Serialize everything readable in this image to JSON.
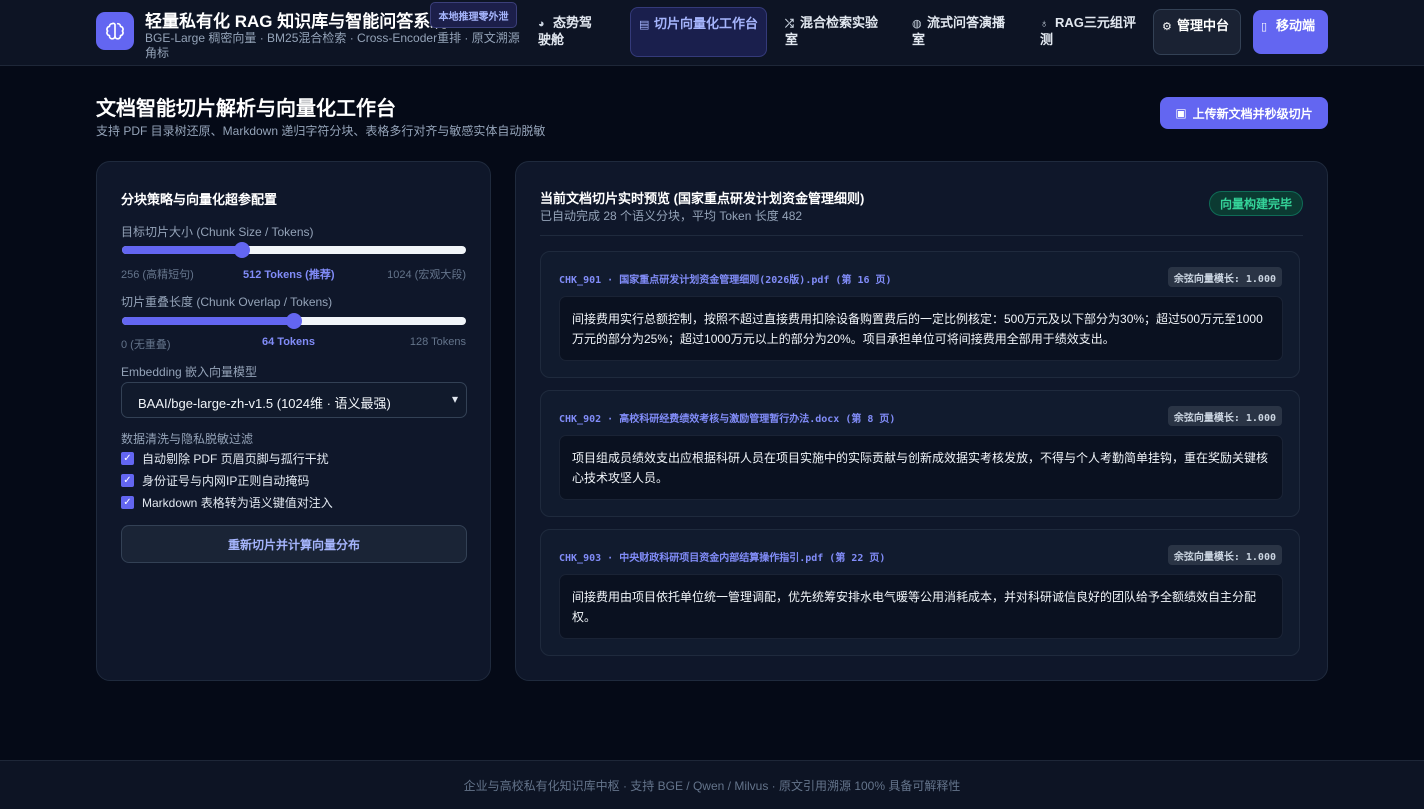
{
  "header": {
    "title": "轻量私有化 RAG 知识库与智能问答系统",
    "badge": "本地推理零外泄",
    "subtitle": "BGE-Large 稠密向量 · BM25混合检索 · Cross-Encoder重排 · 原文溯源角标",
    "logo_icon": "brain-icon",
    "nav": [
      {
        "icon": "dashboard-icon",
        "label": "态势驾驶舱",
        "active": false
      },
      {
        "icon": "document-icon",
        "label": "切片向量化工作台",
        "active": true
      },
      {
        "icon": "shuffle-icon",
        "label": "混合检索实验室",
        "active": false
      },
      {
        "icon": "chat-icon",
        "label": "流式问答演播室",
        "active": false
      },
      {
        "icon": "medal-icon",
        "label": "RAG三元组评测",
        "active": false
      },
      {
        "icon": "gear-icon",
        "label": "管理中台",
        "active": false
      },
      {
        "icon": "mobile-icon",
        "label": "移动端",
        "active": false
      }
    ]
  },
  "page": {
    "title": "文档智能切片解析与向量化工作台",
    "subtitle": "支持 PDF 目录树还原、Markdown 递归字符分块、表格多行对齐与敏感实体自动脱敏",
    "upload_button": "上传新文档并秒级切片"
  },
  "config": {
    "title": "分块策略与向量化超参配置",
    "chunk_size": {
      "label": "目标切片大小 (Chunk Size / Tokens)",
      "value_fraction": 0.35,
      "min_label": "256 (高精短句)",
      "current_label": "512 Tokens (推荐)",
      "max_label": "1024 (宏观大段)"
    },
    "chunk_overlap": {
      "label": "切片重叠长度 (Chunk Overlap / Tokens)",
      "value_fraction": 0.5,
      "min_label": "0 (无重叠)",
      "current_label": "64 Tokens",
      "max_label": "128 Tokens"
    },
    "embedding": {
      "label": "Embedding 嵌入向量模型",
      "selected": "BAAI/bge-large-zh-v1.5 (1024维 · 语义最强)"
    },
    "cleaning": {
      "label": "数据清洗与隐私脱敏过滤",
      "options": [
        {
          "label": "自动剔除 PDF 页眉页脚与孤行干扰",
          "checked": true
        },
        {
          "label": "身份证号与内网IP正则自动掩码",
          "checked": true
        },
        {
          "label": "Markdown 表格转为语义键值对注入",
          "checked": true
        }
      ]
    },
    "rebuild_button": "重新切片并计算向量分布"
  },
  "preview": {
    "title": "当前文档切片实时预览 (国家重点研发计划资金管理细则)",
    "subtitle": "已自动完成 28 个语义分块，平均 Token 长度 482",
    "status": "向量构建完毕",
    "chunks": [
      {
        "header": "CHK_901 · 国家重点研发计划资金管理细则(2026版).pdf (第 16 页)",
        "score": "余弦向量模长: 1.000",
        "text": "间接费用实行总额控制，按照不超过直接费用扣除设备购置费后的一定比例核定：500万元及以下部分为30%；超过500万元至1000万元的部分为25%；超过1000万元以上的部分为20%。项目承担单位可将间接费用全部用于绩效支出。"
      },
      {
        "header": "CHK_902 · 高校科研经费绩效考核与激励管理暂行办法.docx (第 8 页)",
        "score": "余弦向量模长: 1.000",
        "text": "项目组成员绩效支出应根据科研人员在项目实施中的实际贡献与创新成效据实考核发放，不得与个人考勤简单挂钩，重在奖励关键核心技术攻坚人员。"
      },
      {
        "header": "CHK_903 · 中央财政科研项目资金内部结算操作指引.pdf (第 22 页)",
        "score": "余弦向量模长: 1.000",
        "text": "间接费用由项目依托单位统一管理调配，优先统筹安排水电气暖等公用消耗成本，并对科研诚信良好的团队给予全额绩效自主分配权。"
      }
    ]
  },
  "footer": {
    "text": "企业与高校私有化知识库中枢 · 支持 BGE / Qwen / Milvus · 原文引用溯源 100% 具备可解释性"
  },
  "colors": {
    "accent": "#6366f1",
    "success": "#34d399",
    "background": "#050a17"
  }
}
